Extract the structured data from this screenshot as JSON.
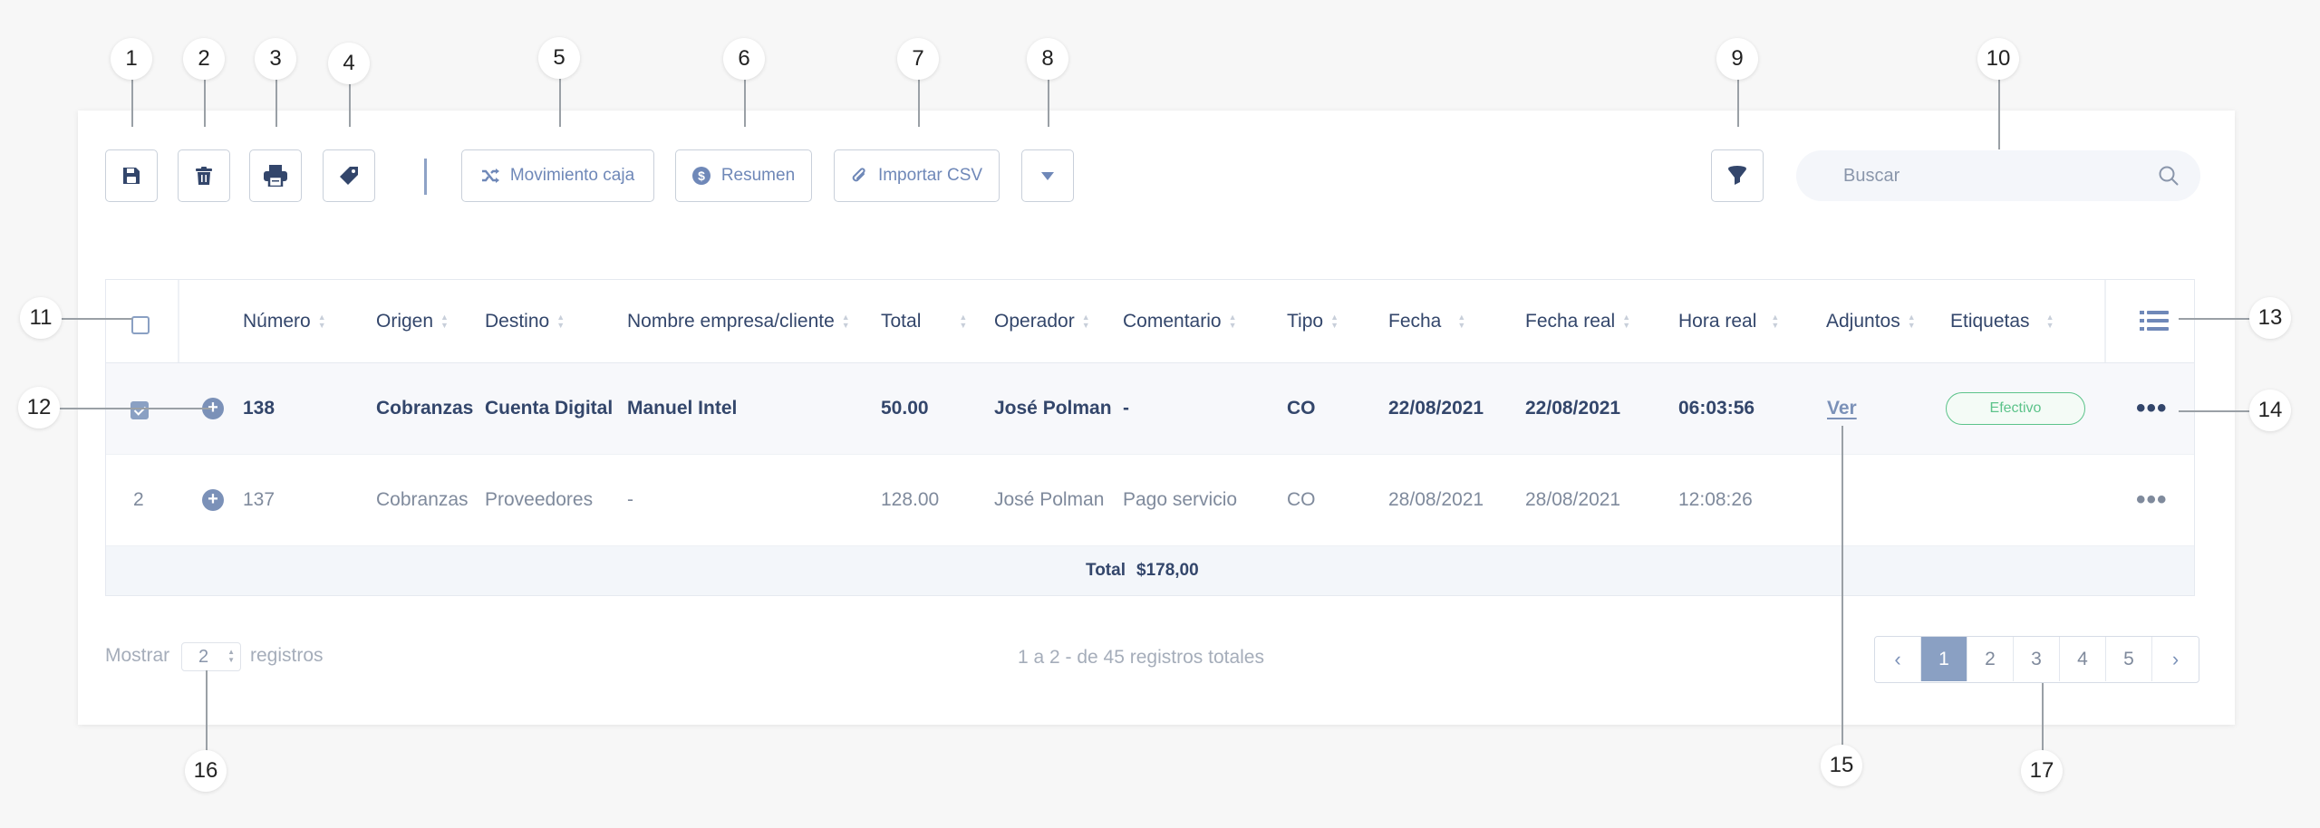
{
  "toolbar": {
    "save_icon": "floppy-disk-icon",
    "delete_icon": "trash-icon",
    "print_icon": "printer-icon",
    "tag_icon": "tag-icon",
    "btn_movimiento": "Movimiento caja",
    "btn_resumen": "Resumen",
    "btn_importar": "Importar CSV",
    "more_icon": "caret-down-icon",
    "filter_icon": "filter-icon"
  },
  "search": {
    "placeholder": "Buscar"
  },
  "table": {
    "columns": [
      "Número",
      "Origen",
      "Destino",
      "Nombre empresa/cliente",
      "Total",
      "Operador",
      "Comentario",
      "Tipo",
      "Fecha",
      "Fecha real",
      "Hora real",
      "Adjuntos",
      "Etiquetas"
    ],
    "rows": [
      {
        "index": "",
        "numero": "138",
        "origen": "Cobranzas",
        "destino": "Cuenta Digital",
        "nombre": "Manuel Intel",
        "total": "50.00",
        "operador": "José Polman",
        "comentario": "-",
        "tipo": "CO",
        "fecha": "22/08/2021",
        "fecha_real": "22/08/2021",
        "hora_real": "06:03:56",
        "adjuntos": "Ver",
        "etiqueta": "Efectivo",
        "selected": true
      },
      {
        "index": "2",
        "numero": "137",
        "origen": "Cobranzas",
        "destino": "Proveedores",
        "nombre": "-",
        "total": "128.00",
        "operador": "José Polman",
        "comentario": "Pago servicio",
        "tipo": "CO",
        "fecha": "28/08/2021",
        "fecha_real": "28/08/2021",
        "hora_real": "12:08:26",
        "adjuntos": "",
        "etiqueta": "",
        "selected": false
      }
    ],
    "total_label": "Total",
    "total_value": "$178,00",
    "row_menu": "•••"
  },
  "footer": {
    "show_label": "Mostrar",
    "show_value": "2",
    "records_label": "registros",
    "summary": "1 a 2 - de 45 registros totales",
    "pages": [
      "1",
      "2",
      "3",
      "4",
      "5"
    ],
    "active_page": "1",
    "prev": "‹",
    "next": "›"
  },
  "callouts": [
    "1",
    "2",
    "3",
    "4",
    "5",
    "6",
    "7",
    "8",
    "9",
    "10",
    "11",
    "12",
    "13",
    "14",
    "15",
    "16",
    "17"
  ],
  "colors": {
    "accent": "#7b91b8",
    "tag_green": "#5cc38a",
    "text_dark": "#33466b"
  }
}
